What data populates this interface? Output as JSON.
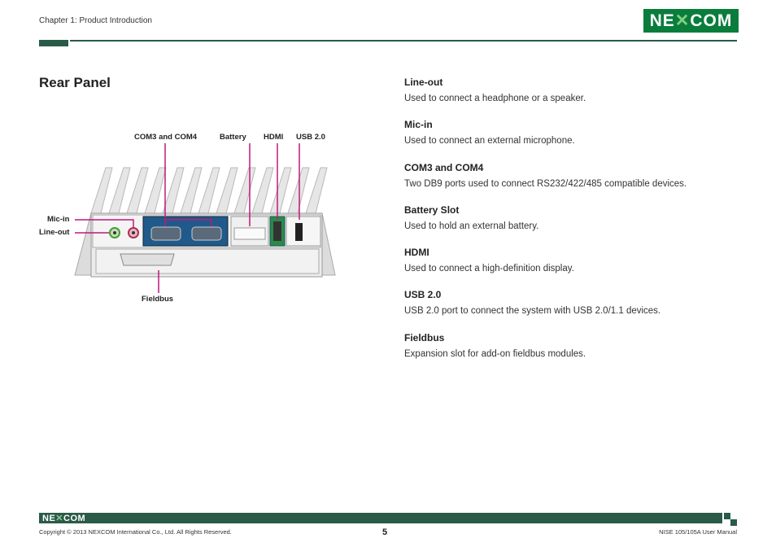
{
  "header": {
    "chapter": "Chapter 1: Product Introduction",
    "logo": "NE COM"
  },
  "section_title": "Rear Panel",
  "diagram": {
    "labels": {
      "com": "COM3 and COM4",
      "battery": "Battery",
      "hdmi": "HDMI",
      "usb": "USB 2.0",
      "mic_in": "Mic-in",
      "line_out": "Line-out",
      "fieldbus": "Fieldbus"
    },
    "colors": {
      "callout": "#c0187a",
      "com_panel": "#1f5a8a",
      "hdmi_panel": "#2a8a4a"
    }
  },
  "items": [
    {
      "title": "Line-out",
      "desc": "Used to connect a headphone or a speaker."
    },
    {
      "title": "Mic-in",
      "desc": "Used to connect an external microphone."
    },
    {
      "title": "COM3 and COM4",
      "desc": "Two DB9 ports used to connect RS232/422/485 compatible devices."
    },
    {
      "title": "Battery Slot",
      "desc": "Used to hold an external battery."
    },
    {
      "title": "HDMI",
      "desc": "Used to connect a high-definition display."
    },
    {
      "title": "USB 2.0",
      "desc": "USB 2.0 port to connect the system with USB 2.0/1.1 devices."
    },
    {
      "title": "Fieldbus",
      "desc": "Expansion slot for add-on fieldbus modules."
    }
  ],
  "footer": {
    "logo": "NE COM",
    "copyright": "Copyright © 2013 NEXCOM International Co., Ltd. All Rights Reserved.",
    "page": "5",
    "manual": "NISE 105/105A User Manual"
  }
}
